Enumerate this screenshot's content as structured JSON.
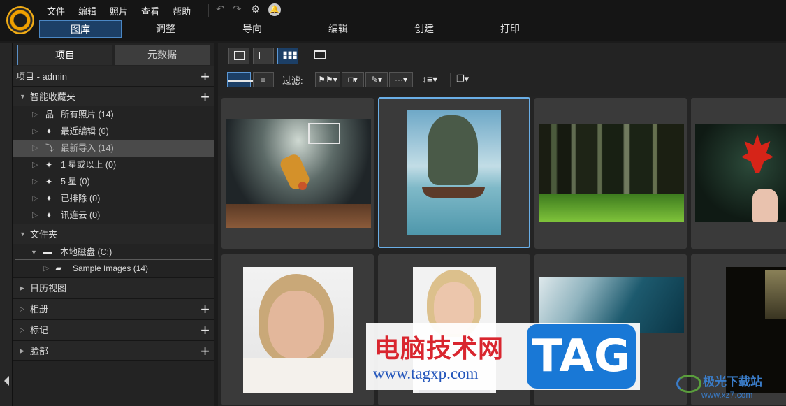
{
  "menu": [
    "文件",
    "编辑",
    "照片",
    "查看",
    "帮助"
  ],
  "modules": [
    "图库",
    "调整",
    "导向",
    "编辑",
    "创建",
    "打印"
  ],
  "panel_tabs": {
    "project": "项目",
    "metadata": "元数据"
  },
  "tree": {
    "project_header": "项目 - admin",
    "smart_collections": {
      "label": "智能收藏夹",
      "items": [
        {
          "label": "所有照片 (14)",
          "icon": "hierarchy-icon"
        },
        {
          "label": "最近编辑 (0)",
          "icon": "magic-wand-icon"
        },
        {
          "label": "最新导入 (14)",
          "icon": "import-icon"
        },
        {
          "label": "1 星或以上 (0)",
          "icon": "magic-wand-icon"
        },
        {
          "label": "5 星 (0)",
          "icon": "magic-wand-icon"
        },
        {
          "label": "已排除 (0)",
          "icon": "magic-wand-icon"
        },
        {
          "label": "讯连云 (0)",
          "icon": "magic-wand-icon"
        }
      ]
    },
    "folders": {
      "label": "文件夹",
      "drive": "本地磁盘 (C:)",
      "subfolder": "Sample Images (14)"
    },
    "calendar": "日历视图",
    "albums": "相册",
    "tags": "标记",
    "faces": "脸部"
  },
  "filter_label": "过滤:",
  "photos": [
    {
      "name": "basketball-player",
      "selected": false
    },
    {
      "name": "sea-rock-boat",
      "selected": true
    },
    {
      "name": "forest",
      "selected": false
    },
    {
      "name": "maple-leaf-hand",
      "selected": false
    },
    {
      "name": "smiling-woman",
      "selected": false
    },
    {
      "name": "smiling-girl",
      "selected": false
    },
    {
      "name": "ocean-wave",
      "selected": false
    },
    {
      "name": "dark-window",
      "selected": false
    }
  ],
  "watermark": {
    "title": "电脑技术网",
    "url": "www.tagxp.com",
    "badge": "TAG",
    "site_name": "极光下载站",
    "site_url": "www.xz7.com"
  }
}
